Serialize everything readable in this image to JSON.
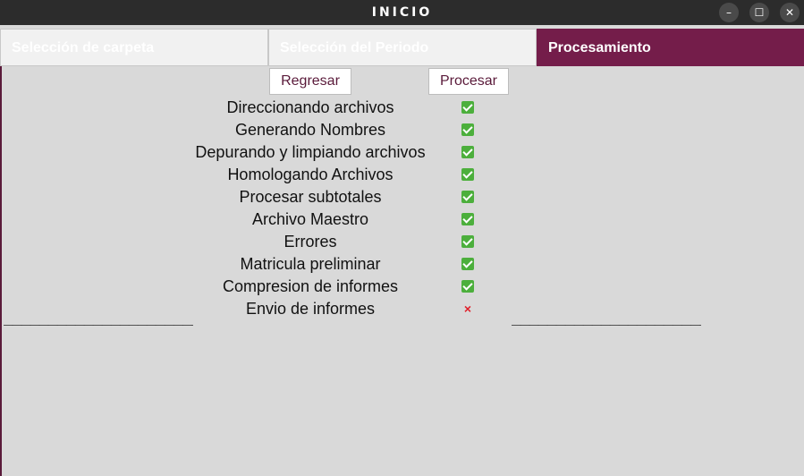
{
  "window": {
    "title": "INICIO",
    "controls": {
      "minimize": "–",
      "maximize": "☐",
      "close": "✕"
    }
  },
  "tabs": [
    {
      "label": "Selección de carpeta",
      "active": false
    },
    {
      "label": "Selección del Periodo",
      "active": false
    },
    {
      "label": "Procesamiento",
      "active": true
    }
  ],
  "buttons": {
    "back": "Regresar",
    "process": "Procesar"
  },
  "steps": [
    {
      "label": "Direccionando archivos",
      "status": "done"
    },
    {
      "label": "Generando Nombres",
      "status": "done"
    },
    {
      "label": "Depurando y limpiando archivos",
      "status": "done"
    },
    {
      "label": "Homologando Archivos",
      "status": "done"
    },
    {
      "label": "Procesar subtotales",
      "status": "done"
    },
    {
      "label": "Archivo Maestro",
      "status": "done"
    },
    {
      "label": "Errores",
      "status": "done"
    },
    {
      "label": "Matricula preliminar",
      "status": "done"
    },
    {
      "label": "Compresion de informes",
      "status": "done"
    },
    {
      "label": "Envio de informes",
      "status": "failed",
      "symbol": "×"
    }
  ],
  "separators": {
    "left": "_________________________",
    "right": "_________________________"
  },
  "colors": {
    "accent": "#741d4a",
    "success": "#4caf3c",
    "error": "#e0202a"
  }
}
